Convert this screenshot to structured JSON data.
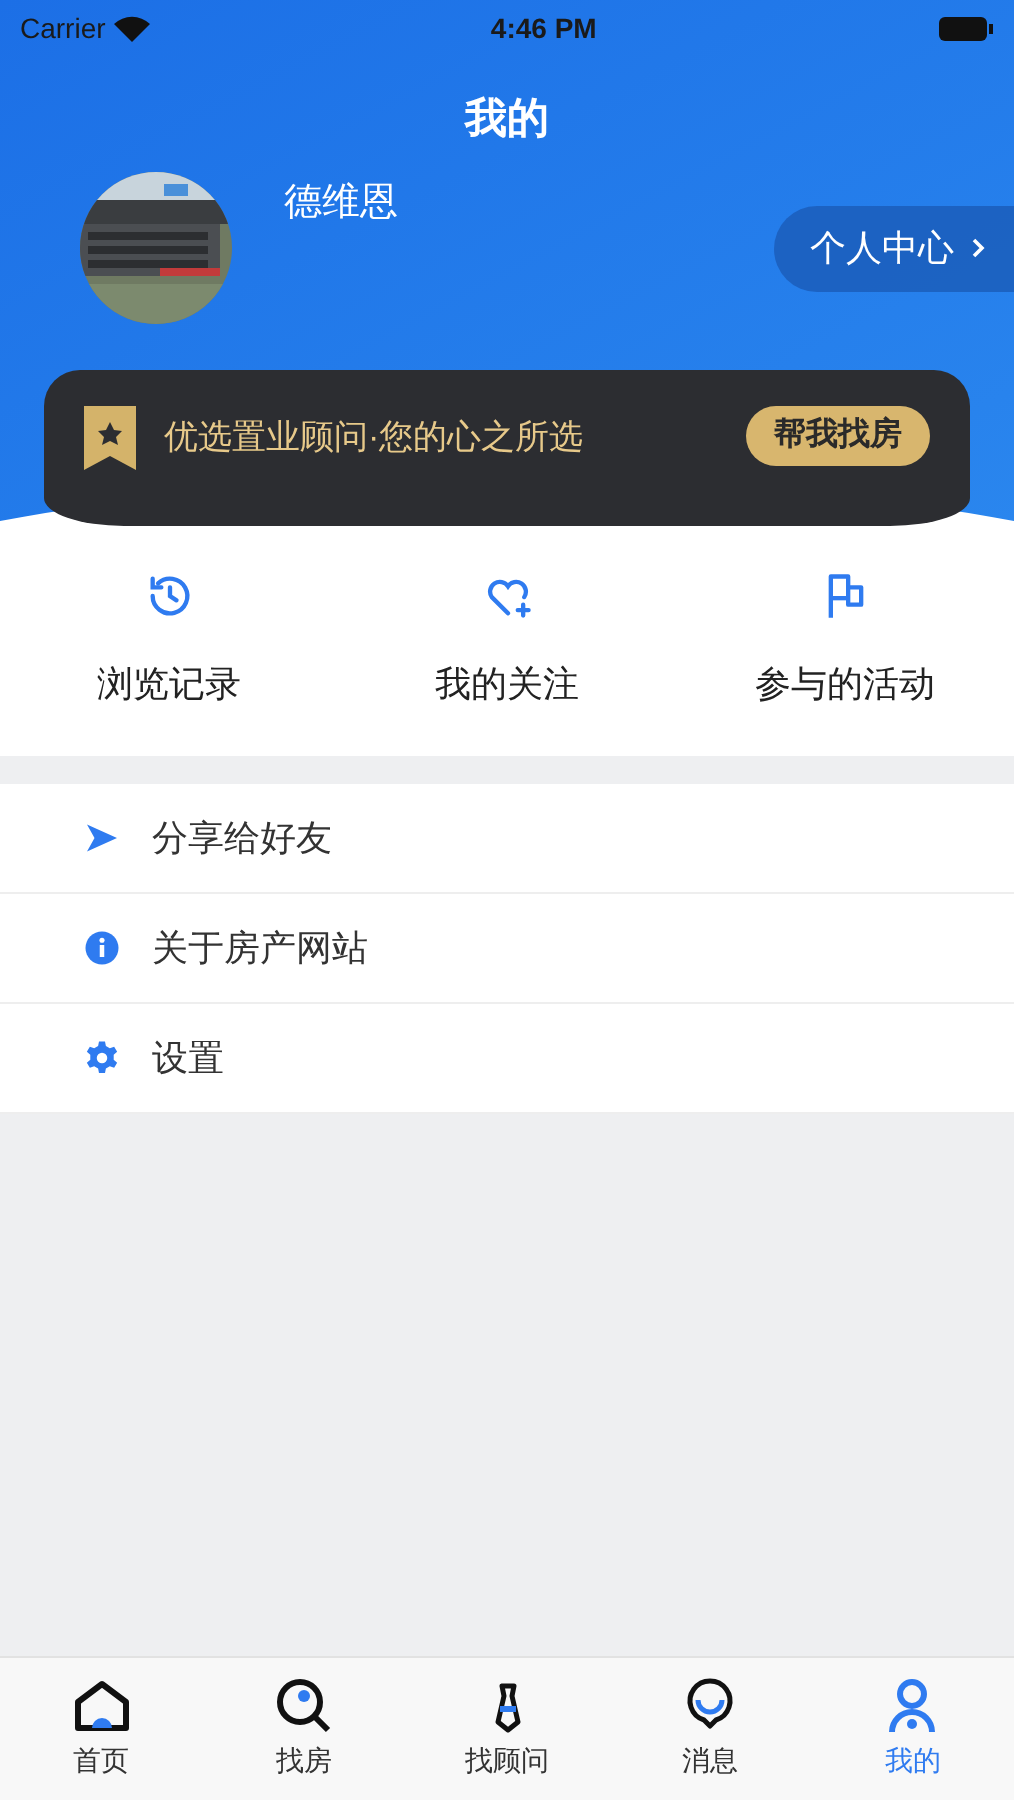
{
  "status_bar": {
    "carrier": "Carrier",
    "time": "4:46 PM"
  },
  "header": {
    "title": "我的",
    "user_name": "德维恩",
    "profile_button": "个人中心"
  },
  "banner": {
    "text": "优选置业顾问·您的心之所选",
    "button": "帮我找房"
  },
  "quick_links": [
    {
      "label": "浏览记录"
    },
    {
      "label": "我的关注"
    },
    {
      "label": "参与的活动"
    }
  ],
  "menu": [
    {
      "label": "分享给好友"
    },
    {
      "label": "关于房产网站"
    },
    {
      "label": "设置"
    }
  ],
  "tabs": [
    {
      "label": "首页",
      "selected": false
    },
    {
      "label": "找房",
      "selected": false
    },
    {
      "label": "找顾问",
      "selected": false
    },
    {
      "label": "消息",
      "selected": false
    },
    {
      "label": "我的",
      "selected": true
    }
  ]
}
